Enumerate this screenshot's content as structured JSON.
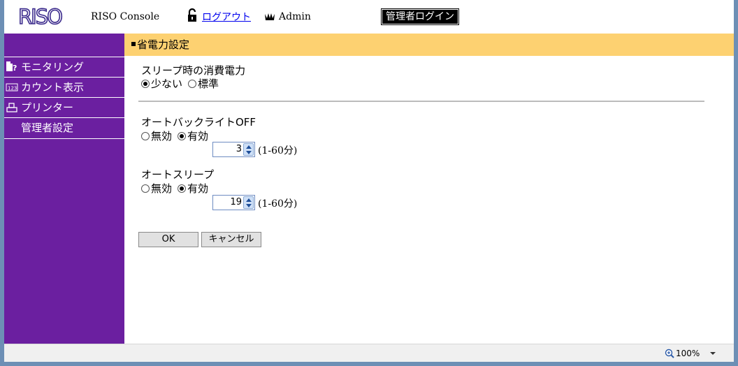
{
  "header": {
    "logo_text": "RISO",
    "console_title": "RISO Console",
    "logout_label": "ログアウト",
    "user_name": "Admin",
    "admin_login_label": "管理者ログイン"
  },
  "sidebar": {
    "items": [
      {
        "label": "モニタリング",
        "icon": "monitoring-icon"
      },
      {
        "label": "カウント表示",
        "icon": "counter-icon"
      },
      {
        "label": "プリンター",
        "icon": "printer-icon"
      },
      {
        "label": "管理者設定",
        "icon": ""
      }
    ]
  },
  "main": {
    "section_title": "省電力設定",
    "sleep_power": {
      "label": "スリープ時の消費電力",
      "options": [
        "少ない",
        "標準"
      ],
      "selected": "少ない"
    },
    "auto_backlight": {
      "label": "オートバックライトOFF",
      "options": [
        "無効",
        "有効"
      ],
      "selected": "有効",
      "value": "3",
      "range": "(1-60分)"
    },
    "auto_sleep": {
      "label": "オートスリープ",
      "options": [
        "無効",
        "有効"
      ],
      "selected": "有効",
      "value": "19",
      "range": "(1-60分)"
    },
    "ok_label": "OK",
    "cancel_label": "キャンセル"
  },
  "statusbar": {
    "zoom": "100%"
  },
  "colors": {
    "sidebar": "#6b1fa0",
    "section_bar": "#fdd171",
    "logo": "#3b2a8c"
  }
}
